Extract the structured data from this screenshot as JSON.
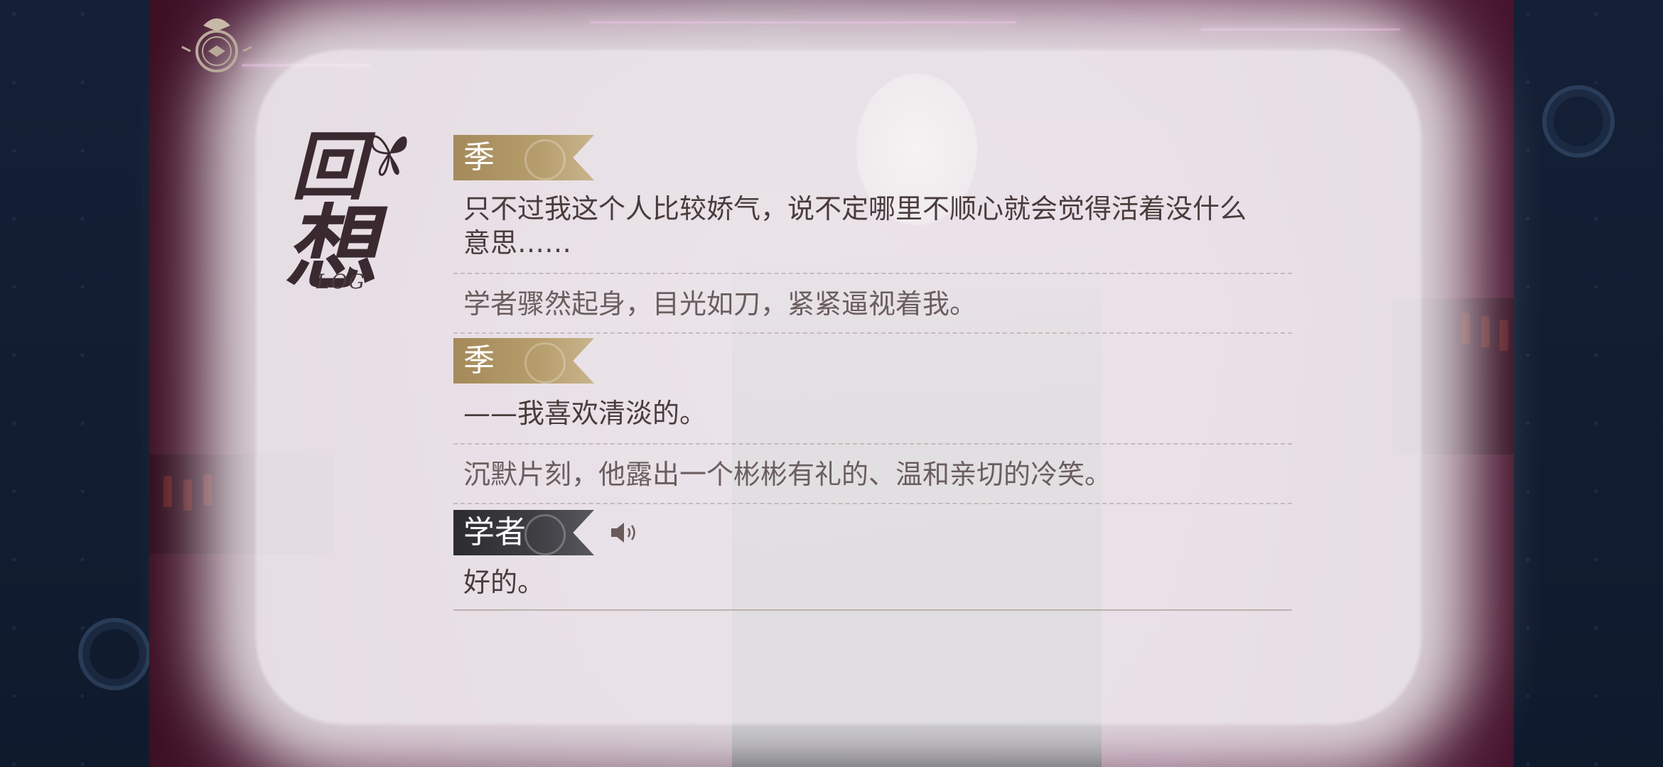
{
  "app": {
    "screen": "log"
  },
  "header": {
    "title_line1": "回",
    "title_line2": "想",
    "title_sub": "LOG"
  },
  "entries": [
    {
      "speaker": "季",
      "style": "gold",
      "text": "只不过我这个人比较娇气，说不定哪里不顺心就会觉得活着没什么意思……",
      "voice": false
    },
    {
      "speaker": "",
      "style": "narration",
      "text": "学者骤然起身，目光如刀，紧紧逼视着我。",
      "voice": false
    },
    {
      "speaker": "季",
      "style": "gold",
      "text": "——我喜欢清淡的。",
      "voice": false
    },
    {
      "speaker": "",
      "style": "narration",
      "text": "沉默片刻，他露出一个彬彬有礼的、温和亲切的冷笑。",
      "voice": false
    },
    {
      "speaker": "学者",
      "style": "dark",
      "text": "好的。",
      "voice": true
    }
  ],
  "icons": {
    "menu": "compass-emblem-icon",
    "voice": "speaker-icon",
    "decoration": "butterfly-icon"
  },
  "colors": {
    "gold_tag": "#b69d6c",
    "dark_tag": "#3f3f44",
    "side_panel": "#142036"
  }
}
